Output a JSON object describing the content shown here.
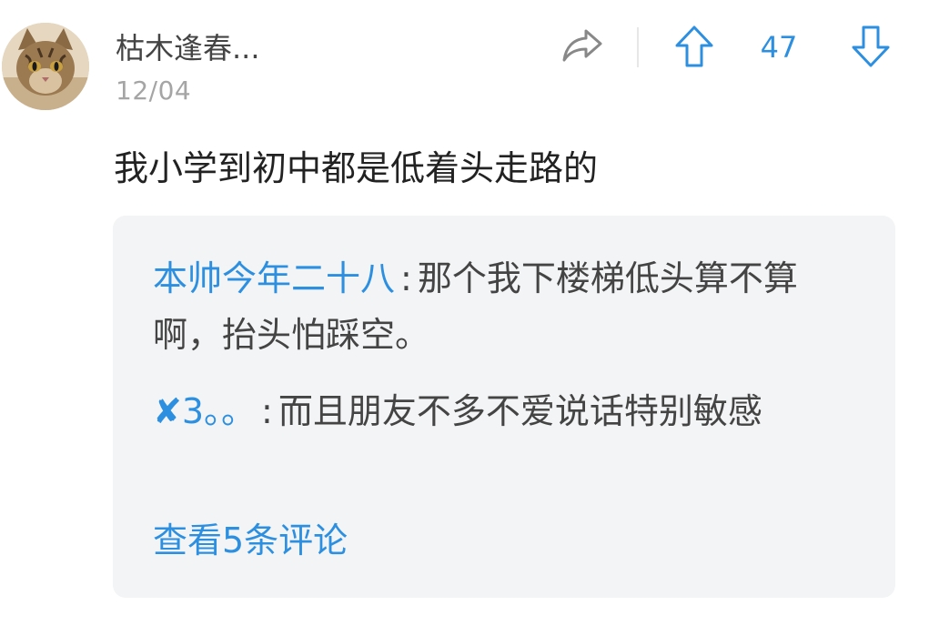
{
  "post": {
    "author": "枯木逢春...",
    "date": "12/04",
    "text": "我小学到初中都是低着头走路的",
    "vote_count": "47"
  },
  "icons": {
    "avatar": "cat-avatar",
    "share": "share-arrow-icon",
    "upvote": "arrow-up-icon",
    "downvote": "arrow-down-icon"
  },
  "colors": {
    "accent": "#2d8fe0",
    "text": "#222222",
    "secondary_text": "#a5a5a5",
    "comment_bg": "#f3f4f6"
  },
  "comments": [
    {
      "author": "本帅今年二十八",
      "separator": ":",
      "text": "那个我下楼梯低头算不算啊，抬头怕踩空。"
    },
    {
      "author_icon": "✘",
      "author": "3。。",
      "separator": ":",
      "text": "而且朋友不多不爱说话特别敏感"
    }
  ],
  "view_more_label": "查看5条评论"
}
